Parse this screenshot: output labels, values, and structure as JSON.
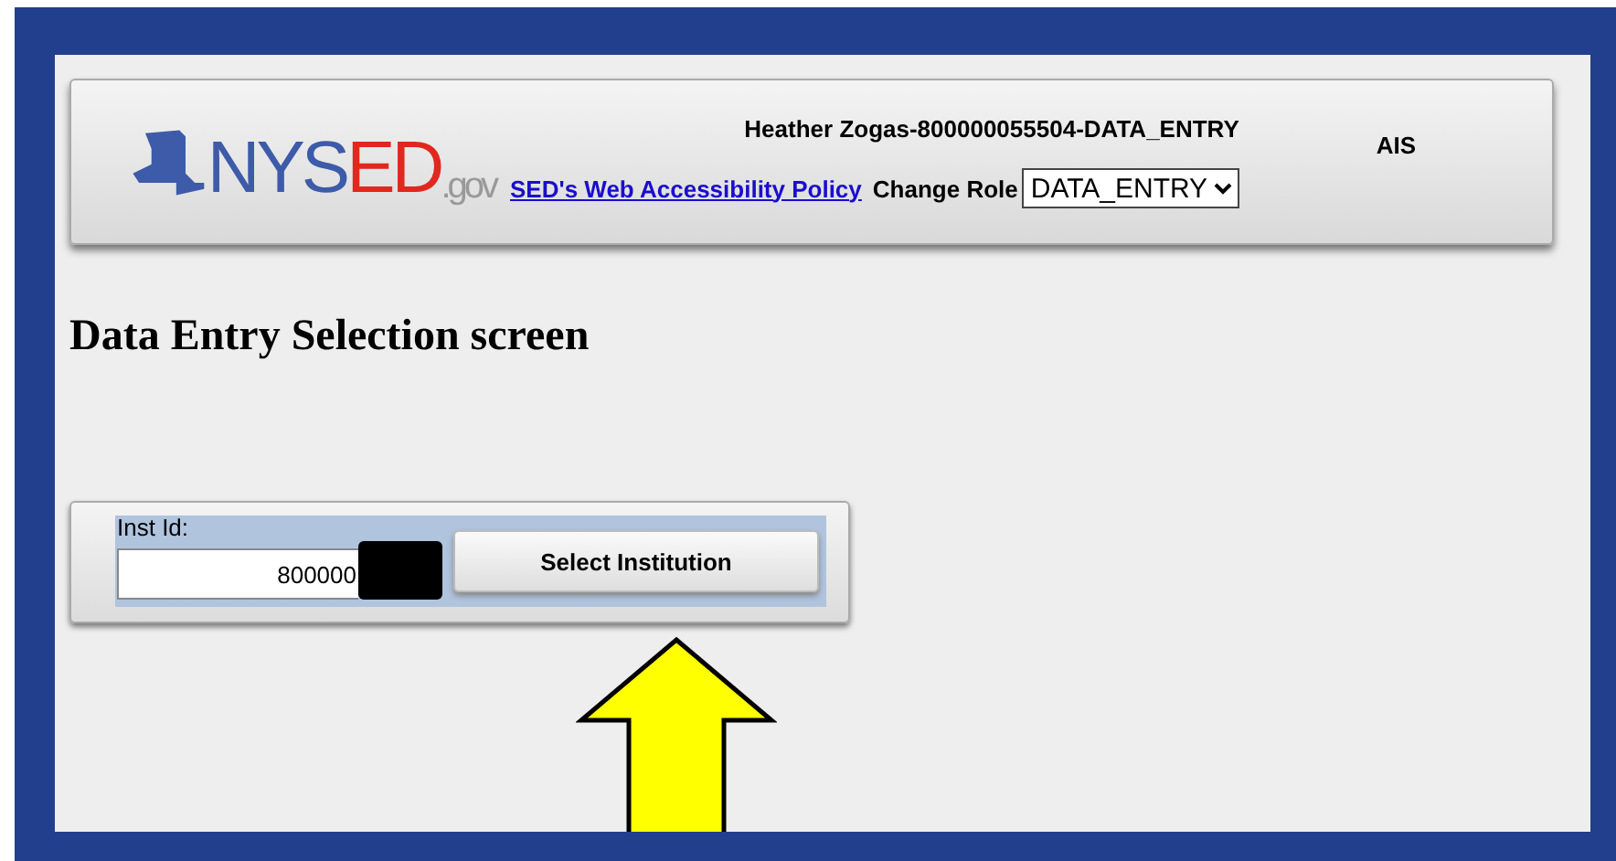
{
  "header": {
    "logo": {
      "primary": "NYS",
      "accent": "ED",
      "suffix": ".gov"
    },
    "user_line": "Heather Zogas-800000055504-DATA_ENTRY",
    "app_code": "AIS",
    "accessibility_link": "SED's Web Accessibility Policy",
    "role_label": "Change Role",
    "role_value": "DATA_ENTRY"
  },
  "page_title": "Data Entry Selection screen",
  "form": {
    "field_label": "Inst Id:",
    "field_value": "800000",
    "redacted": true,
    "button": "Select Institution"
  },
  "annotation": {
    "kind": "arrow"
  }
}
